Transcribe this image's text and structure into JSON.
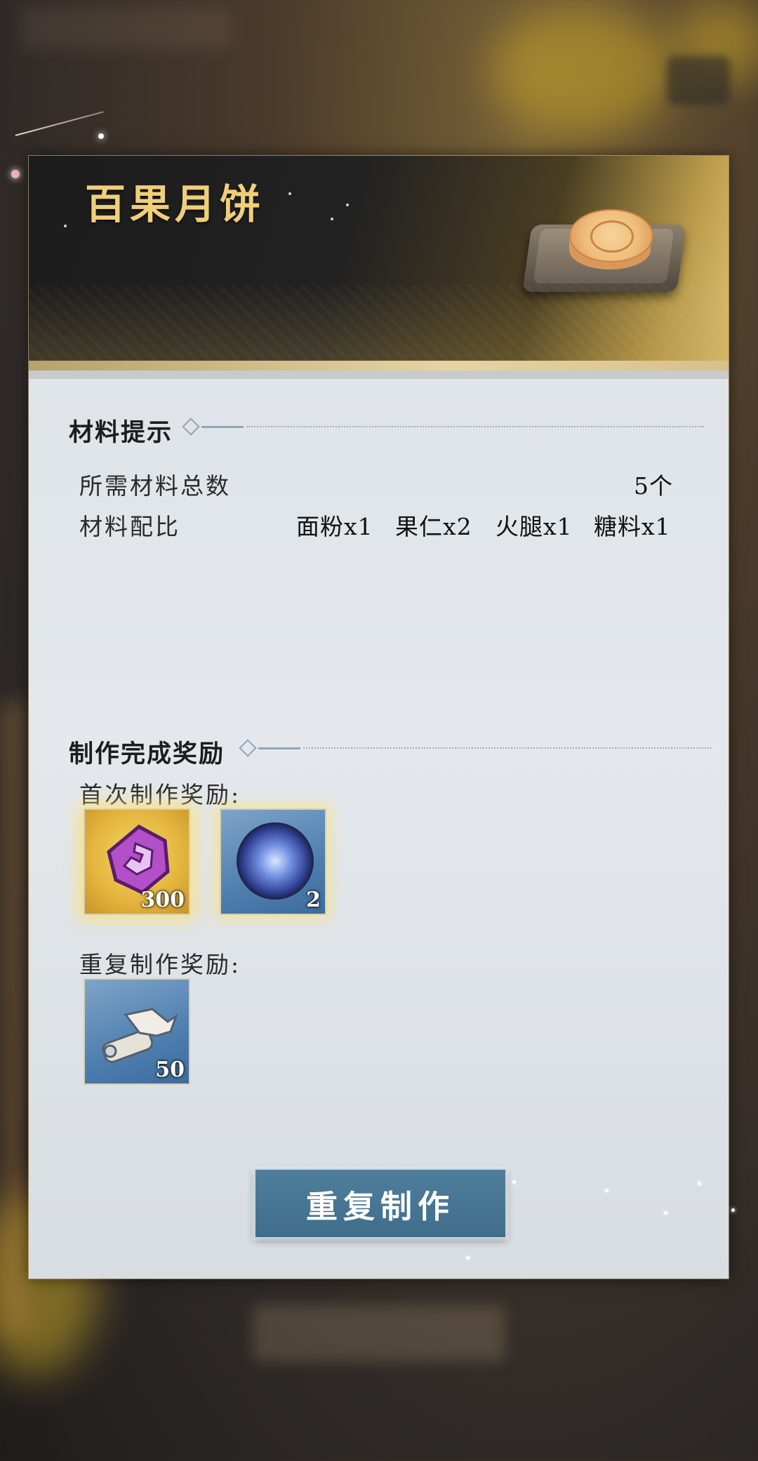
{
  "recipe": {
    "title": "百果月饼"
  },
  "materials": {
    "section_title": "材料提示",
    "total_label": "所需材料总数",
    "total_value": "5个",
    "ratio_label": "材料配比",
    "ratio": [
      {
        "text": "面粉x1"
      },
      {
        "text": "果仁x2"
      },
      {
        "text": "火腿x1"
      },
      {
        "text": "糖料x1"
      }
    ]
  },
  "rewards": {
    "section_title": "制作完成奖励",
    "first_label": "首次制作奖励:",
    "first_items": [
      {
        "icon": "purple-crest-icon",
        "count": "300"
      },
      {
        "icon": "blue-orb-icon",
        "count": "2"
      }
    ],
    "repeat_label": "重复制作奖励:",
    "repeat_items": [
      {
        "icon": "scroll-icon",
        "count": "50"
      }
    ]
  },
  "actions": {
    "repeat_craft_label": "重复制作"
  },
  "colors": {
    "title_gold": "#f0cf7a",
    "button_blue": "#4a7896",
    "panel_body": "#e2e6ea"
  }
}
